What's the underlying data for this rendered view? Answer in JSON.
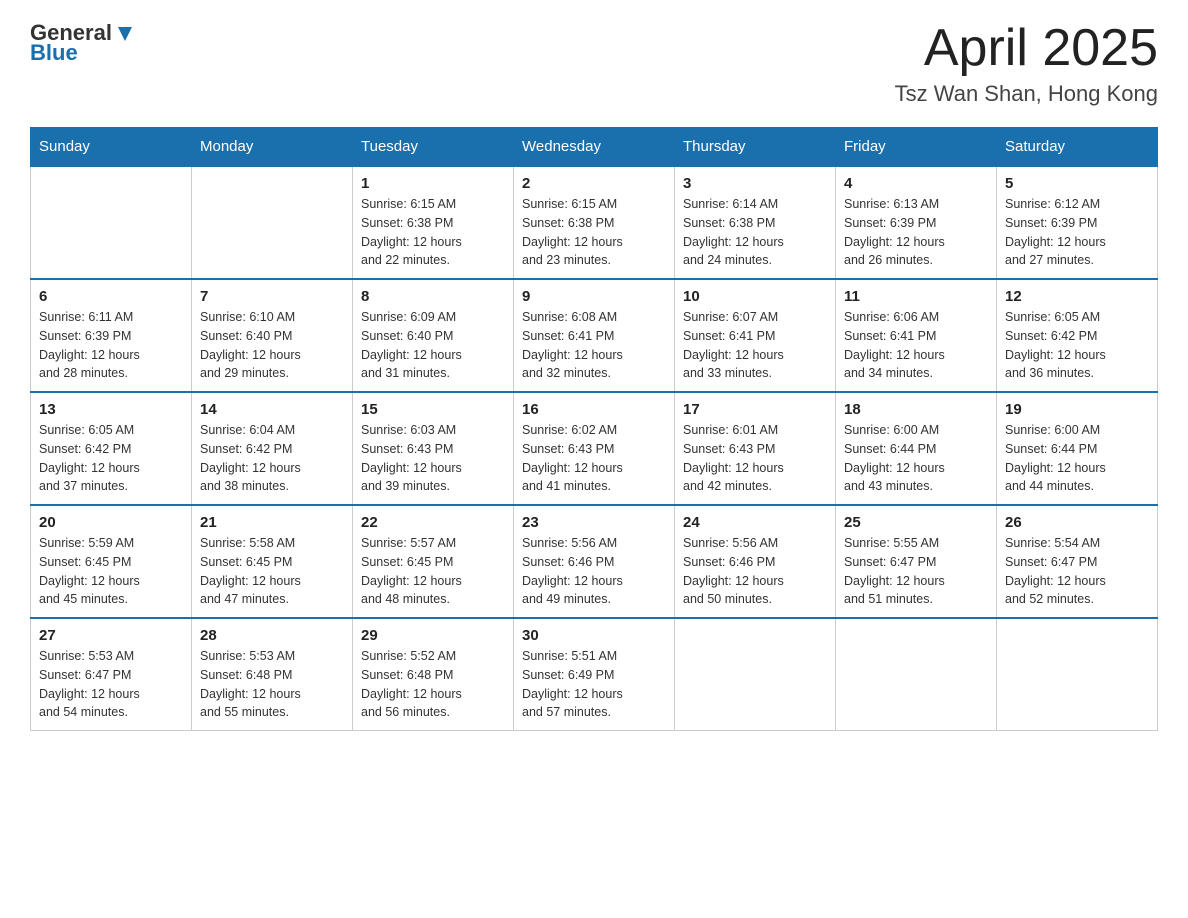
{
  "logo": {
    "general": "General",
    "blue": "Blue"
  },
  "title": {
    "month_year": "April 2025",
    "location": "Tsz Wan Shan, Hong Kong"
  },
  "header_days": [
    "Sunday",
    "Monday",
    "Tuesday",
    "Wednesday",
    "Thursday",
    "Friday",
    "Saturday"
  ],
  "weeks": [
    [
      {
        "day": "",
        "info": ""
      },
      {
        "day": "",
        "info": ""
      },
      {
        "day": "1",
        "info": "Sunrise: 6:15 AM\nSunset: 6:38 PM\nDaylight: 12 hours\nand 22 minutes."
      },
      {
        "day": "2",
        "info": "Sunrise: 6:15 AM\nSunset: 6:38 PM\nDaylight: 12 hours\nand 23 minutes."
      },
      {
        "day": "3",
        "info": "Sunrise: 6:14 AM\nSunset: 6:38 PM\nDaylight: 12 hours\nand 24 minutes."
      },
      {
        "day": "4",
        "info": "Sunrise: 6:13 AM\nSunset: 6:39 PM\nDaylight: 12 hours\nand 26 minutes."
      },
      {
        "day": "5",
        "info": "Sunrise: 6:12 AM\nSunset: 6:39 PM\nDaylight: 12 hours\nand 27 minutes."
      }
    ],
    [
      {
        "day": "6",
        "info": "Sunrise: 6:11 AM\nSunset: 6:39 PM\nDaylight: 12 hours\nand 28 minutes."
      },
      {
        "day": "7",
        "info": "Sunrise: 6:10 AM\nSunset: 6:40 PM\nDaylight: 12 hours\nand 29 minutes."
      },
      {
        "day": "8",
        "info": "Sunrise: 6:09 AM\nSunset: 6:40 PM\nDaylight: 12 hours\nand 31 minutes."
      },
      {
        "day": "9",
        "info": "Sunrise: 6:08 AM\nSunset: 6:41 PM\nDaylight: 12 hours\nand 32 minutes."
      },
      {
        "day": "10",
        "info": "Sunrise: 6:07 AM\nSunset: 6:41 PM\nDaylight: 12 hours\nand 33 minutes."
      },
      {
        "day": "11",
        "info": "Sunrise: 6:06 AM\nSunset: 6:41 PM\nDaylight: 12 hours\nand 34 minutes."
      },
      {
        "day": "12",
        "info": "Sunrise: 6:05 AM\nSunset: 6:42 PM\nDaylight: 12 hours\nand 36 minutes."
      }
    ],
    [
      {
        "day": "13",
        "info": "Sunrise: 6:05 AM\nSunset: 6:42 PM\nDaylight: 12 hours\nand 37 minutes."
      },
      {
        "day": "14",
        "info": "Sunrise: 6:04 AM\nSunset: 6:42 PM\nDaylight: 12 hours\nand 38 minutes."
      },
      {
        "day": "15",
        "info": "Sunrise: 6:03 AM\nSunset: 6:43 PM\nDaylight: 12 hours\nand 39 minutes."
      },
      {
        "day": "16",
        "info": "Sunrise: 6:02 AM\nSunset: 6:43 PM\nDaylight: 12 hours\nand 41 minutes."
      },
      {
        "day": "17",
        "info": "Sunrise: 6:01 AM\nSunset: 6:43 PM\nDaylight: 12 hours\nand 42 minutes."
      },
      {
        "day": "18",
        "info": "Sunrise: 6:00 AM\nSunset: 6:44 PM\nDaylight: 12 hours\nand 43 minutes."
      },
      {
        "day": "19",
        "info": "Sunrise: 6:00 AM\nSunset: 6:44 PM\nDaylight: 12 hours\nand 44 minutes."
      }
    ],
    [
      {
        "day": "20",
        "info": "Sunrise: 5:59 AM\nSunset: 6:45 PM\nDaylight: 12 hours\nand 45 minutes."
      },
      {
        "day": "21",
        "info": "Sunrise: 5:58 AM\nSunset: 6:45 PM\nDaylight: 12 hours\nand 47 minutes."
      },
      {
        "day": "22",
        "info": "Sunrise: 5:57 AM\nSunset: 6:45 PM\nDaylight: 12 hours\nand 48 minutes."
      },
      {
        "day": "23",
        "info": "Sunrise: 5:56 AM\nSunset: 6:46 PM\nDaylight: 12 hours\nand 49 minutes."
      },
      {
        "day": "24",
        "info": "Sunrise: 5:56 AM\nSunset: 6:46 PM\nDaylight: 12 hours\nand 50 minutes."
      },
      {
        "day": "25",
        "info": "Sunrise: 5:55 AM\nSunset: 6:47 PM\nDaylight: 12 hours\nand 51 minutes."
      },
      {
        "day": "26",
        "info": "Sunrise: 5:54 AM\nSunset: 6:47 PM\nDaylight: 12 hours\nand 52 minutes."
      }
    ],
    [
      {
        "day": "27",
        "info": "Sunrise: 5:53 AM\nSunset: 6:47 PM\nDaylight: 12 hours\nand 54 minutes."
      },
      {
        "day": "28",
        "info": "Sunrise: 5:53 AM\nSunset: 6:48 PM\nDaylight: 12 hours\nand 55 minutes."
      },
      {
        "day": "29",
        "info": "Sunrise: 5:52 AM\nSunset: 6:48 PM\nDaylight: 12 hours\nand 56 minutes."
      },
      {
        "day": "30",
        "info": "Sunrise: 5:51 AM\nSunset: 6:49 PM\nDaylight: 12 hours\nand 57 minutes."
      },
      {
        "day": "",
        "info": ""
      },
      {
        "day": "",
        "info": ""
      },
      {
        "day": "",
        "info": ""
      }
    ]
  ]
}
